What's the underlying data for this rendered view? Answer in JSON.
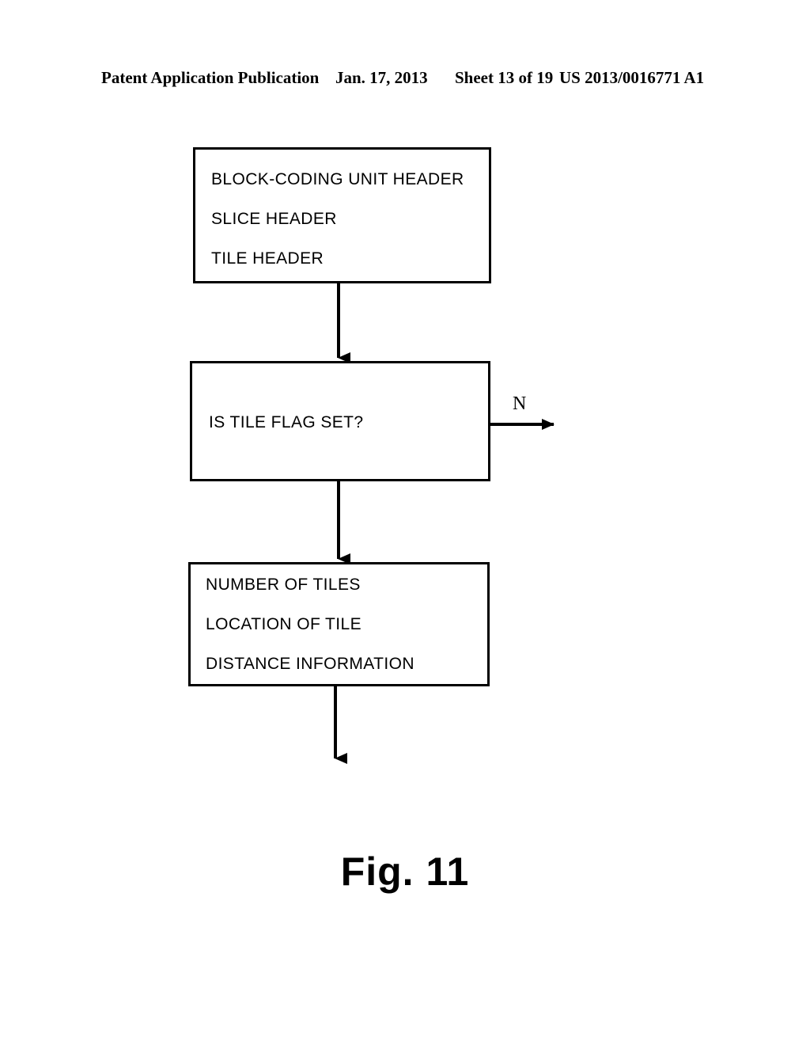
{
  "header": {
    "publication": "Patent Application Publication",
    "date": "Jan. 17, 2013",
    "sheet": "Sheet 13 of 19",
    "document_number": "US 2013/0016771 A1"
  },
  "figure": {
    "caption": "Fig. 11",
    "stroke_color": "#000000",
    "background_color": "#ffffff"
  },
  "flowchart": {
    "type": "flowchart",
    "nodes": [
      {
        "id": "header-fields",
        "shape": "rectangle",
        "lines": [
          "BLOCK-CODING UNIT HEADER",
          "SLICE HEADER",
          "TILE HEADER"
        ]
      },
      {
        "id": "decision",
        "shape": "rectangle",
        "lines": [
          "IS TILE FLAG SET?"
        ]
      },
      {
        "id": "tile-info",
        "shape": "rectangle",
        "lines": [
          "NUMBER OF TILES",
          "LOCATION OF TILE",
          "DISTANCE INFORMATION"
        ]
      }
    ],
    "edges": [
      {
        "id": "edge-header-to-decision",
        "from": "header-fields",
        "to": "decision",
        "label": "",
        "direction": "down"
      },
      {
        "id": "edge-decision-no",
        "from": "decision",
        "to": "",
        "label": "N",
        "direction": "right"
      },
      {
        "id": "edge-decision-to-tileinfo",
        "from": "decision",
        "to": "tile-info",
        "label": "",
        "direction": "down"
      },
      {
        "id": "edge-tileinfo-out",
        "from": "tile-info",
        "to": "",
        "label": "",
        "direction": "down"
      }
    ]
  }
}
